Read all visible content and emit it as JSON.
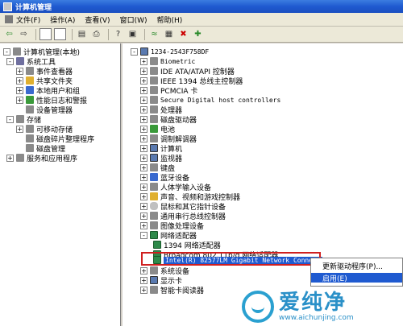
{
  "window": {
    "title": "计算机管理"
  },
  "menu": {
    "items": [
      "文件(F)",
      "操作(A)",
      "查看(V)",
      "窗口(W)",
      "帮助(H)"
    ]
  },
  "toolbar": {
    "icons": [
      "back-icon",
      "forward-icon",
      "up-icon",
      "show-hide-tree-icon",
      "properties-icon",
      "print-icon",
      "help-icon",
      "scan-icon",
      "update-icon",
      "uninstall-icon",
      "disable-icon",
      "enable-icon"
    ]
  },
  "left_tree": [
    {
      "label": "计算机管理(本地)",
      "level": 0,
      "expander": "-"
    },
    {
      "label": "系统工具",
      "level": 1,
      "expander": "-"
    },
    {
      "label": "事件查看器",
      "level": 2,
      "expander": "+"
    },
    {
      "label": "共享文件夹",
      "level": 2,
      "expander": "+"
    },
    {
      "label": "本地用户和组",
      "level": 2,
      "expander": "+"
    },
    {
      "label": "性能日志和警报",
      "level": 2,
      "expander": "+"
    },
    {
      "label": "设备管理器",
      "level": 2,
      "expander": ""
    },
    {
      "label": "存储",
      "level": 1,
      "expander": "-"
    },
    {
      "label": "可移动存储",
      "level": 2,
      "expander": "+"
    },
    {
      "label": "磁盘碎片整理程序",
      "level": 2,
      "expander": ""
    },
    {
      "label": "磁盘管理",
      "level": 2,
      "expander": ""
    },
    {
      "label": "服务和应用程序",
      "level": 1,
      "expander": "+"
    }
  ],
  "right_tree": [
    {
      "label": "1234-2543F758DF",
      "expander": "-",
      "level": 0,
      "mono": true
    },
    {
      "label": "Biometric",
      "expander": "+",
      "level": 1,
      "mono": true
    },
    {
      "label": "IDE ATA/ATAPI 控制器",
      "expander": "+",
      "level": 1
    },
    {
      "label": "IEEE 1394 总线主控制器",
      "expander": "+",
      "level": 1
    },
    {
      "label": "PCMCIA 卡",
      "expander": "+",
      "level": 1
    },
    {
      "label": "Secure Digital host controllers",
      "expander": "+",
      "level": 1,
      "mono": true
    },
    {
      "label": "处理器",
      "expander": "+",
      "level": 1
    },
    {
      "label": "磁盘驱动器",
      "expander": "+",
      "level": 1
    },
    {
      "label": "电池",
      "expander": "+",
      "level": 1
    },
    {
      "label": "调制解调器",
      "expander": "+",
      "level": 1
    },
    {
      "label": "计算机",
      "expander": "+",
      "level": 1
    },
    {
      "label": "监视器",
      "expander": "+",
      "level": 1
    },
    {
      "label": "键盘",
      "expander": "+",
      "level": 1
    },
    {
      "label": "蓝牙设备",
      "expander": "+",
      "level": 1
    },
    {
      "label": "人体学输入设备",
      "expander": "+",
      "level": 1
    },
    {
      "label": "声音、视频和游戏控制器",
      "expander": "+",
      "level": 1
    },
    {
      "label": "鼠标和其它指针设备",
      "expander": "+",
      "level": 1
    },
    {
      "label": "通用串行总线控制器",
      "expander": "+",
      "level": 1
    },
    {
      "label": "图像处理设备",
      "expander": "+",
      "level": 1
    },
    {
      "label": "网络适配器",
      "expander": "-",
      "level": 1
    },
    {
      "label": "1394 网络适配器",
      "expander": "",
      "level": 2
    },
    {
      "label": "Broadcom 802.11b/g 网络适配器",
      "expander": "",
      "level": 2
    },
    {
      "label": "Intel(R) 82577LM Gigabit Network Connect",
      "expander": "",
      "level": 2,
      "mono": true,
      "selected": true
    },
    {
      "label": "系统设备",
      "expander": "+",
      "level": 1
    },
    {
      "label": "显示卡",
      "expander": "+",
      "level": 1
    },
    {
      "label": "智能卡阅读器",
      "expander": "+",
      "level": 1
    }
  ],
  "context_menu": {
    "items": [
      {
        "label": "更新驱动程序(P)..."
      },
      {
        "label": "启用(E)",
        "active": true
      }
    ]
  },
  "watermark": {
    "cn": "爱纯净",
    "en": "www.aichunjing.com"
  }
}
